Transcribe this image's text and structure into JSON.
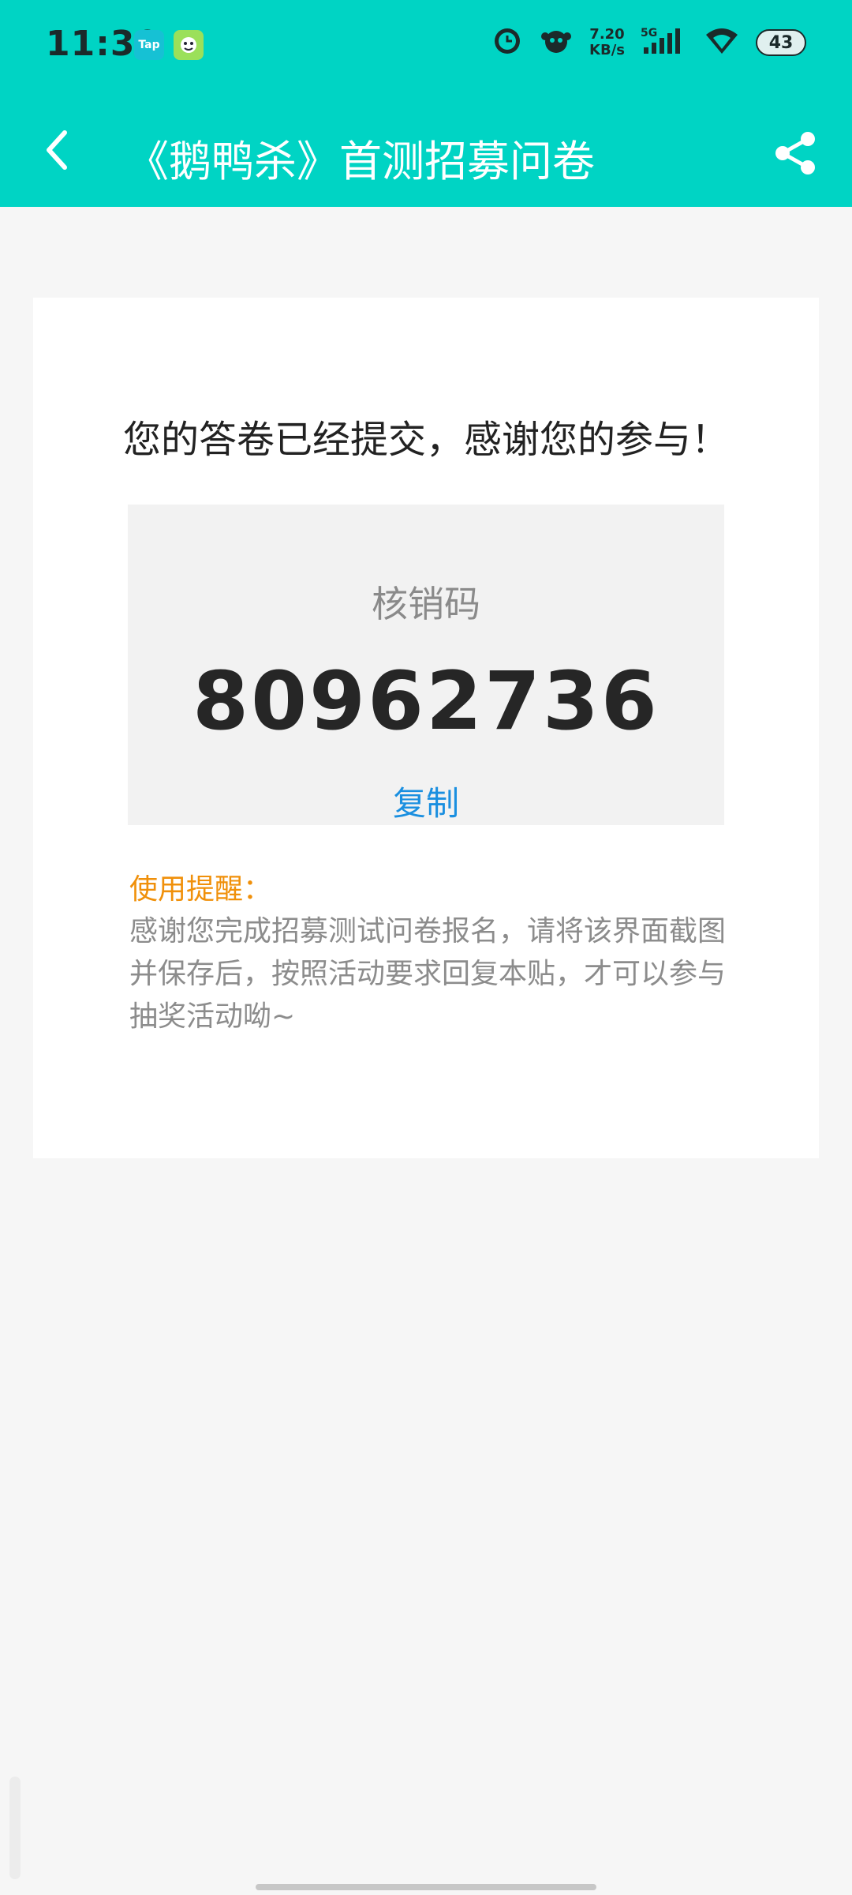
{
  "status_bar": {
    "time": "11:30",
    "app_icons": [
      "Tap",
      ""
    ],
    "network_speed": "7.20\nKB/s",
    "network_type": "5G",
    "battery": "43"
  },
  "app_bar": {
    "title": "《鹅鸭杀》首测招募问卷",
    "back_icon": "chevron-left-icon",
    "share_icon": "share-icon"
  },
  "card": {
    "submitted_message": "您的答卷已经提交，感谢您的参与！",
    "code_label": "核销码",
    "code_value": "80962736",
    "copy_label": "复制",
    "reminder_title": "使用提醒：",
    "reminder_body": "感谢您完成招募测试问卷报名，请将该界面截图并保存后，按照活动要求回复本贴，才可以参与抽奖活动呦~"
  },
  "colors": {
    "header_bg": "#00d4c4",
    "link": "#1a8fe0",
    "reminder_title": "#f0900a",
    "page_bg": "#f6f6f6"
  }
}
